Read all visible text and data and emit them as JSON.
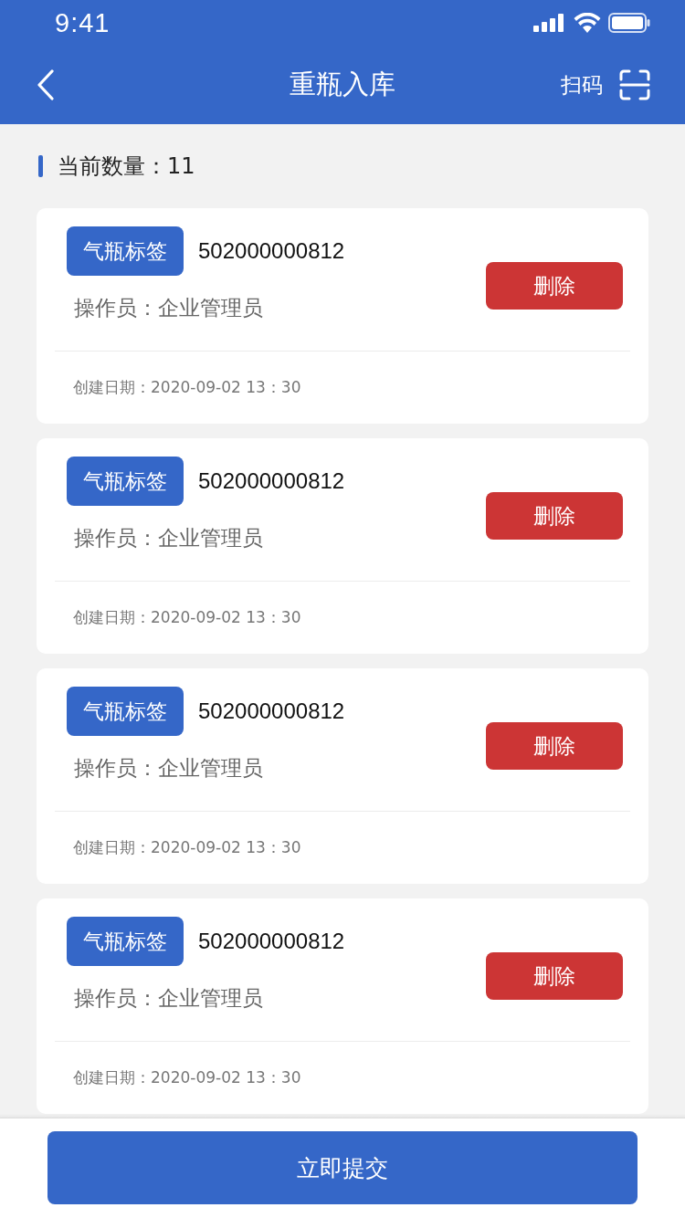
{
  "status_bar": {
    "time": "9:41"
  },
  "header": {
    "title": "重瓶入库",
    "scan_label": "扫码"
  },
  "count": {
    "label": "当前数量：",
    "value": "11"
  },
  "cards": [
    {
      "tag": "气瓶标签",
      "code": "502000000812",
      "operator": "操作员：企业管理员",
      "date": "创建日期：2020-09-02 13：30",
      "delete_label": "删除"
    },
    {
      "tag": "气瓶标签",
      "code": "502000000812",
      "operator": "操作员：企业管理员",
      "date": "创建日期：2020-09-02 13：30",
      "delete_label": "删除"
    },
    {
      "tag": "气瓶标签",
      "code": "502000000812",
      "operator": "操作员：企业管理员",
      "date": "创建日期：2020-09-02 13：30",
      "delete_label": "删除"
    },
    {
      "tag": "气瓶标签",
      "code": "502000000812",
      "operator": "操作员：企业管理员",
      "date": "创建日期：2020-09-02 13：30",
      "delete_label": "删除"
    }
  ],
  "submit_label": "立即提交"
}
